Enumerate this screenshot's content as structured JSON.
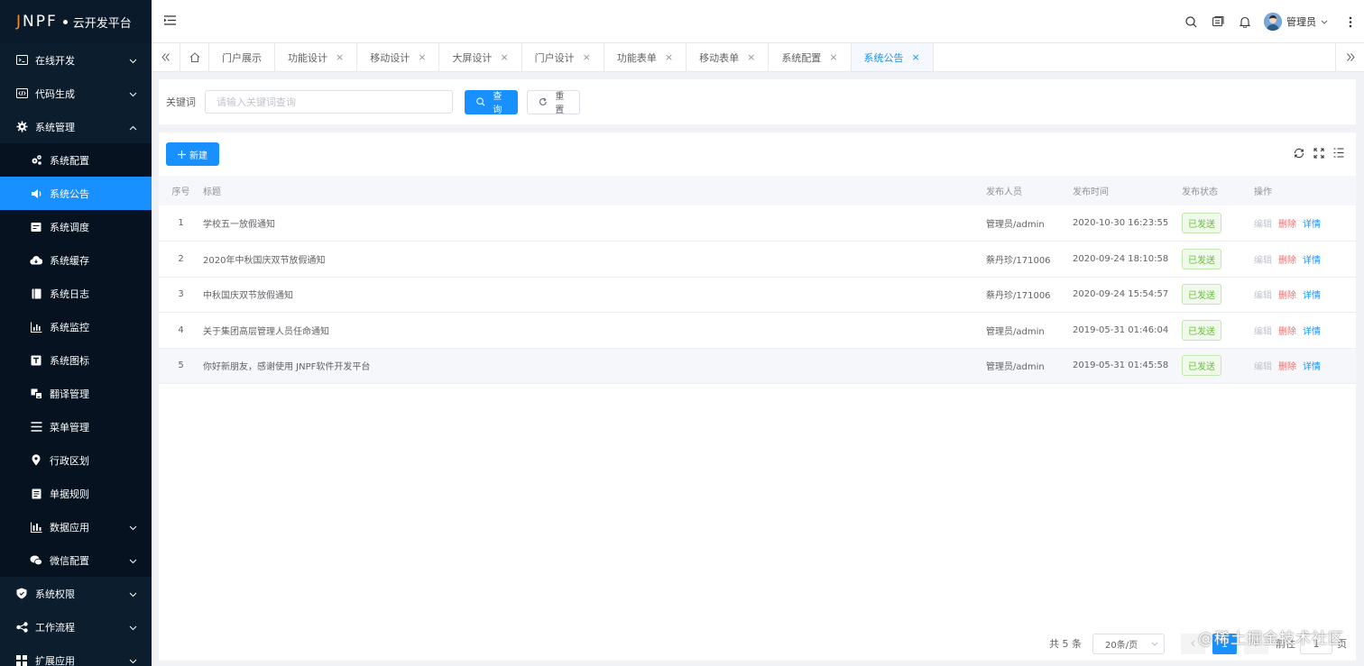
{
  "app": {
    "brand": "JNPF",
    "platform": "云开发平台"
  },
  "sidebar": {
    "items": [
      {
        "label": "在线开发",
        "icon": "dev-icon",
        "expanded": false
      },
      {
        "label": "代码生成",
        "icon": "code-icon",
        "expanded": false
      },
      {
        "label": "系统管理",
        "icon": "gear-icon",
        "expanded": true
      },
      {
        "label": "系统权限",
        "icon": "shield-icon",
        "expanded": false
      },
      {
        "label": "工作流程",
        "icon": "flow-icon",
        "expanded": false
      },
      {
        "label": "扩展应用",
        "icon": "grid-icon",
        "expanded": false
      }
    ],
    "submenu": [
      {
        "label": "系统配置",
        "icon": "gears-icon"
      },
      {
        "label": "系统公告",
        "icon": "speaker-icon",
        "active": true
      },
      {
        "label": "系统调度",
        "icon": "schedule-icon"
      },
      {
        "label": "系统缓存",
        "icon": "cloud-icon"
      },
      {
        "label": "系统日志",
        "icon": "log-icon"
      },
      {
        "label": "系统监控",
        "icon": "monitor-chart-icon"
      },
      {
        "label": "系统图标",
        "icon": "text-icon"
      },
      {
        "label": "翻译管理",
        "icon": "translate-icon"
      },
      {
        "label": "菜单管理",
        "icon": "list-icon"
      },
      {
        "label": "行政区划",
        "icon": "location-icon"
      },
      {
        "label": "单据规则",
        "icon": "document-icon"
      },
      {
        "label": "数据应用",
        "icon": "bar-chart-icon",
        "has_children": true
      },
      {
        "label": "微信配置",
        "icon": "wechat-icon",
        "has_children": true
      }
    ]
  },
  "header": {
    "user_name": "管理员"
  },
  "tabs": [
    {
      "label": "门户展示",
      "closable": false
    },
    {
      "label": "功能设计",
      "closable": true
    },
    {
      "label": "移动设计",
      "closable": true
    },
    {
      "label": "大屏设计",
      "closable": true
    },
    {
      "label": "门户设计",
      "closable": true
    },
    {
      "label": "功能表单",
      "closable": true
    },
    {
      "label": "移动表单",
      "closable": true
    },
    {
      "label": "系统配置",
      "closable": true
    },
    {
      "label": "系统公告",
      "closable": true,
      "active": true
    }
  ],
  "search": {
    "label": "关键词",
    "placeholder": "请输入关键词查询",
    "query_label": "查询",
    "reset_label": "重置"
  },
  "toolbar": {
    "add_label": "新建"
  },
  "table": {
    "columns": [
      "序号",
      "标题",
      "发布人员",
      "发布时间",
      "发布状态",
      "操作"
    ],
    "rows": [
      {
        "idx": "1",
        "title": "学校五一放假通知",
        "publisher": "管理员/admin",
        "time": "2020-10-30 16:23:55",
        "status": "已发送"
      },
      {
        "idx": "2",
        "title": "2020年中秋国庆双节放假通知",
        "publisher": "蔡丹珍/171006",
        "time": "2020-09-24 18:10:58",
        "status": "已发送"
      },
      {
        "idx": "3",
        "title": "中秋国庆双节放假通知",
        "publisher": "蔡丹珍/171006",
        "time": "2020-09-24 15:54:57",
        "status": "已发送"
      },
      {
        "idx": "4",
        "title": "关于集团高层管理人员任命通知",
        "publisher": "管理员/admin",
        "time": "2019-05-31 01:46:04",
        "status": "已发送"
      },
      {
        "idx": "5",
        "title": "你好新朋友，感谢使用 JNPF软件开发平台",
        "publisher": "管理员/admin",
        "time": "2019-05-31 01:45:58",
        "status": "已发送"
      }
    ],
    "actions": {
      "edit": "编辑",
      "delete": "删除",
      "detail": "详情"
    }
  },
  "pagination": {
    "total": "共 5 条",
    "page_size": "20条/页",
    "current": "1",
    "goto": "前往",
    "goto_value": "1",
    "unit": "页"
  },
  "watermark": "@稀土掘金技术社区",
  "colors": {
    "sidebar_bg": "#0c1d2e",
    "accent": "#1890ff",
    "danger": "#f56c6c",
    "success": "#67c23a"
  }
}
